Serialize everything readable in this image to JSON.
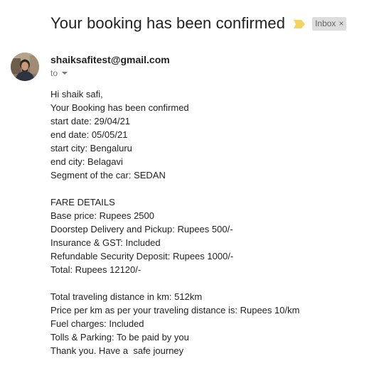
{
  "email": {
    "subject": "Your booking has been confirmed",
    "label": "Inbox",
    "label_close": "×",
    "sender": "shaiksafitest@gmail.com",
    "recipient_prefix": "to",
    "importance_color": "#f4d35e"
  },
  "body": {
    "lines": [
      "Hi shaik safi,",
      "Your Booking has been confirmed",
      "start date: 29/04/21",
      "end date: 05/05/21",
      "start city: Bengaluru",
      "end city: Belagavi",
      "Segment of the car: SEDAN",
      "",
      "FARE DETAILS",
      "Base price: Rupees 2500",
      "Doorstep Delivery and Pickup: Rupees 500/-",
      "Insurance & GST: Included",
      "Refundable Security Deposit: Rupees 1000/-",
      "Total: Rupees 12120/-",
      "",
      "Total traveling distance in km: 512km",
      "Price per km as per your traveling distance is: Rupees 10/km",
      "Fuel charges: Included",
      "Tolls & Parking: To be paid by you",
      "Thank you. Have a  safe journey"
    ]
  }
}
